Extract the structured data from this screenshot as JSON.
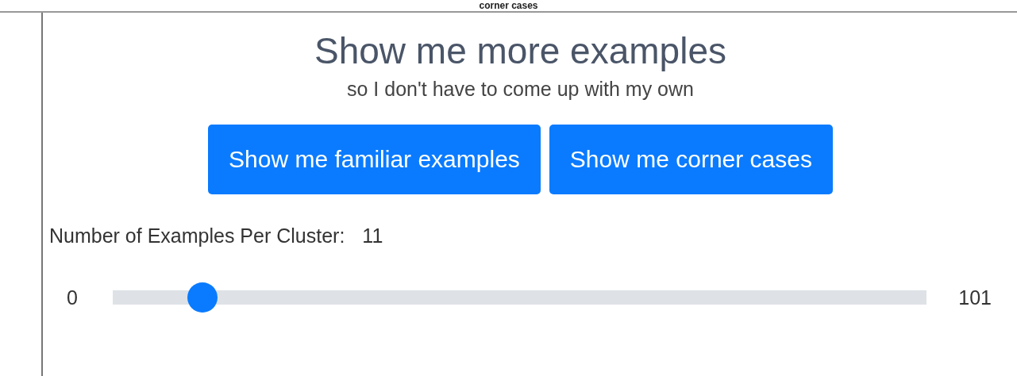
{
  "section_heading": "corner cases",
  "title": "Show me more examples",
  "subtitle": "so I don't have to come up with my own",
  "buttons": [
    "Show me familiar examples",
    "Show me corner cases"
  ],
  "slider": {
    "label": "Number of Examples Per Cluster:",
    "value": "11",
    "min": "0",
    "max": "101",
    "level": 0.11
  }
}
